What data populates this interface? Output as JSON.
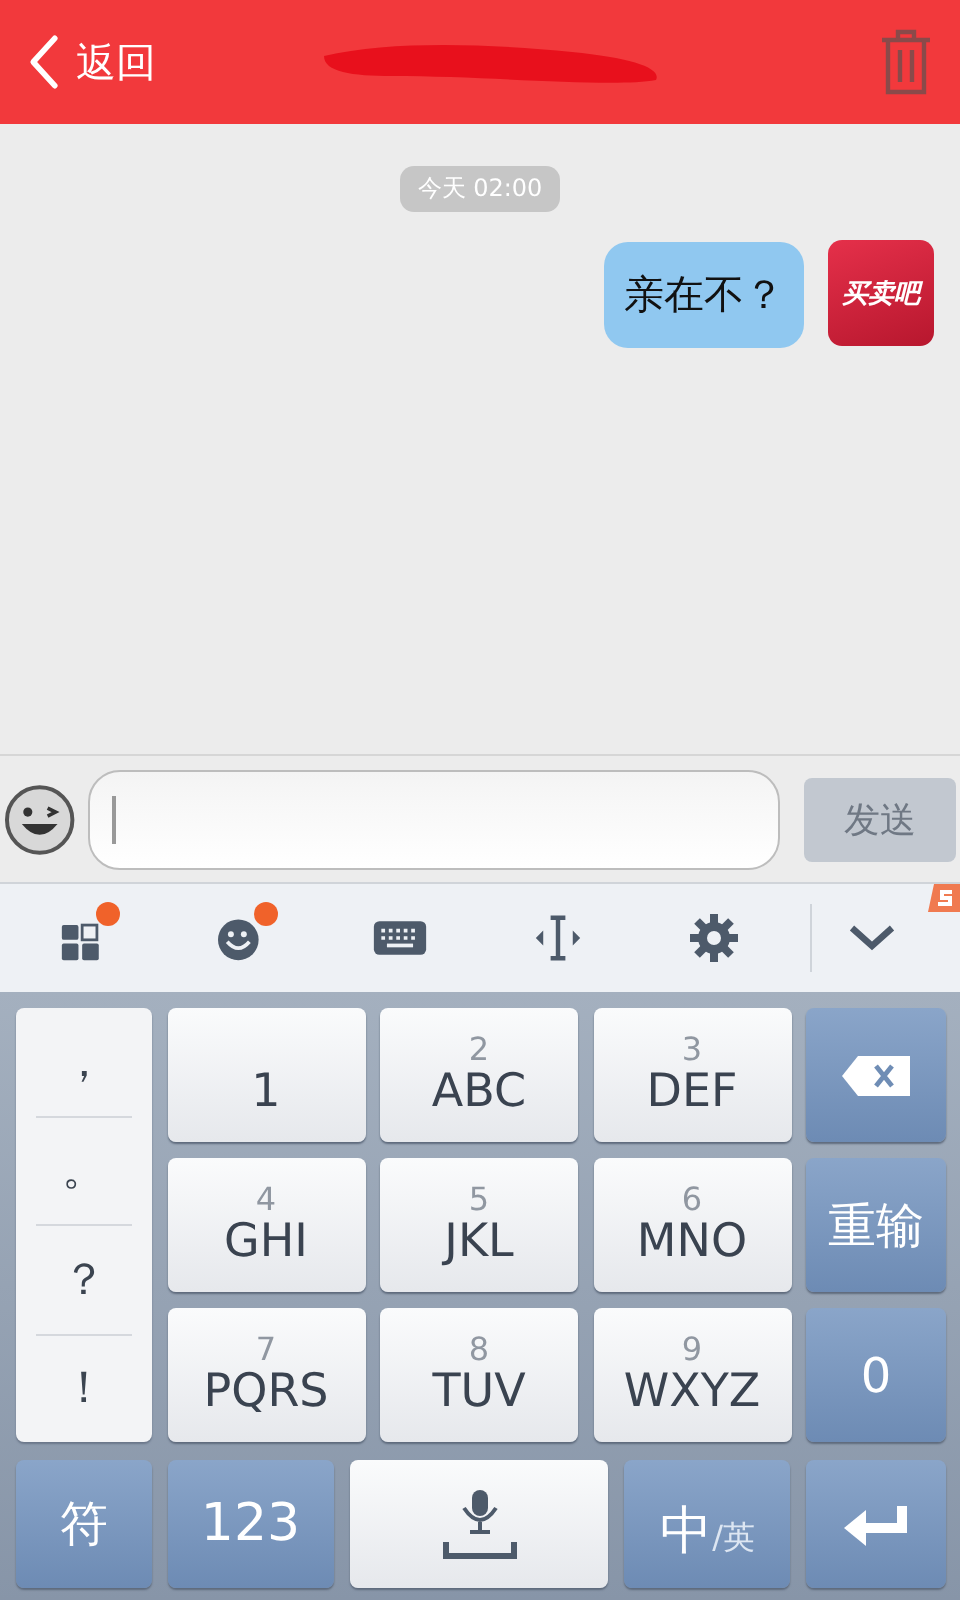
{
  "header": {
    "back_label": "返回"
  },
  "conversation": {
    "timestamp": "今天 02:00",
    "messages": [
      {
        "text": "亲在不？",
        "outgoing": true,
        "avatar_label": "买卖吧"
      }
    ]
  },
  "composer": {
    "send_label": "发送",
    "send_disabled": true
  },
  "ime_toolbar": [
    {
      "kind": "apps",
      "badge": true
    },
    {
      "kind": "emoji",
      "badge": true
    },
    {
      "kind": "keyboard",
      "badge": false
    },
    {
      "kind": "cursor",
      "badge": false
    },
    {
      "kind": "settings",
      "badge": false
    },
    {
      "kind": "collapse",
      "badge": false
    }
  ],
  "keyboard": {
    "symbols": [
      "，",
      "。",
      "？",
      "！"
    ],
    "key_rows": [
      [
        {
          "label": "1"
        },
        {
          "digit": "2",
          "label": "ABC"
        },
        {
          "digit": "3",
          "label": "DEF"
        }
      ],
      [
        {
          "digit": "4",
          "label": "GHI"
        },
        {
          "digit": "5",
          "label": "JKL"
        },
        {
          "digit": "6",
          "label": "MNO"
        }
      ],
      [
        {
          "digit": "7",
          "label": "PQRS"
        },
        {
          "digit": "8",
          "label": "TUV"
        },
        {
          "digit": "9",
          "label": "WXYZ"
        }
      ]
    ],
    "side_keys": [
      {
        "kind": "backspace"
      },
      {
        "kind": "text",
        "label": "重输"
      },
      {
        "kind": "text",
        "label": "0"
      }
    ],
    "bottom_keys": [
      {
        "kind": "text",
        "label": "符"
      },
      {
        "kind": "text",
        "label": "123"
      },
      {
        "kind": "space"
      },
      {
        "kind": "lang",
        "label": "中",
        "sub": "/英"
      },
      {
        "kind": "enter"
      }
    ]
  }
}
